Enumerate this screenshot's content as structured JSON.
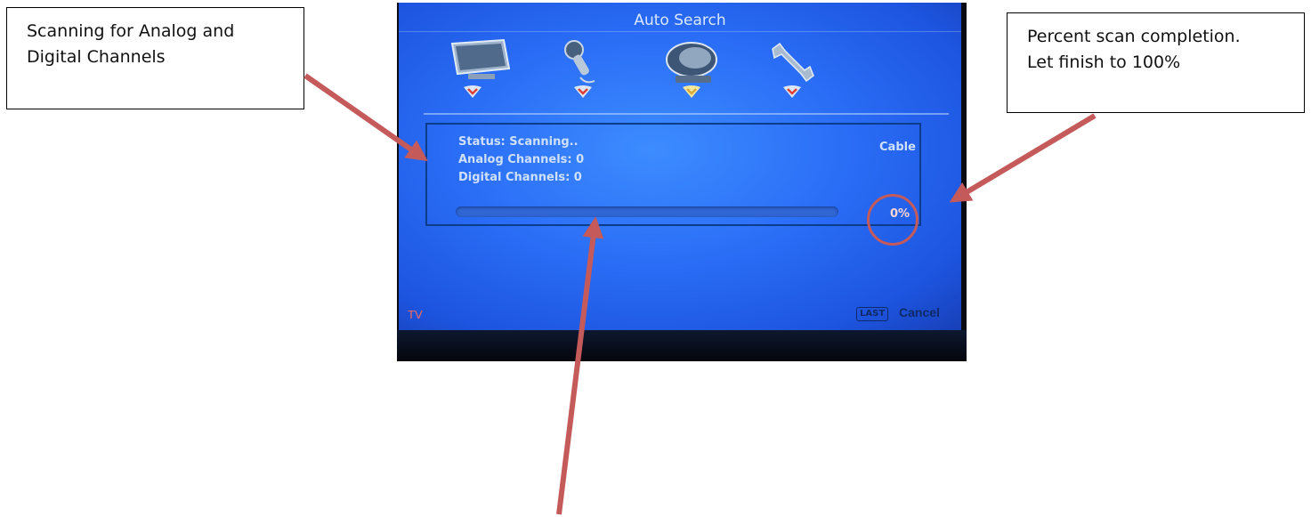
{
  "callouts": {
    "left": [
      "Scanning for Analog and",
      "Digital Channels"
    ],
    "right": [
      "Percent scan completion.",
      "Let finish to 100%"
    ]
  },
  "osd": {
    "title": "Auto Search",
    "menu_icons": [
      "tv-monitor-icon",
      "microphone-icon",
      "satellite-dish-icon",
      "wrench-icon"
    ],
    "status_label": "Status: Scanning..",
    "analog_label": "Analog Channels: 0",
    "digital_label": "Digital Channels: 0",
    "signal_type": "Cable",
    "progress_percent": 0,
    "progress_text": "0%",
    "footer_source": "TV",
    "last_key": "LAST",
    "cancel_label": "Cancel"
  },
  "colors": {
    "osd_blue": "#2a6df6",
    "arrow": "#c55a5a",
    "footer_source": "#ff6b5e"
  }
}
